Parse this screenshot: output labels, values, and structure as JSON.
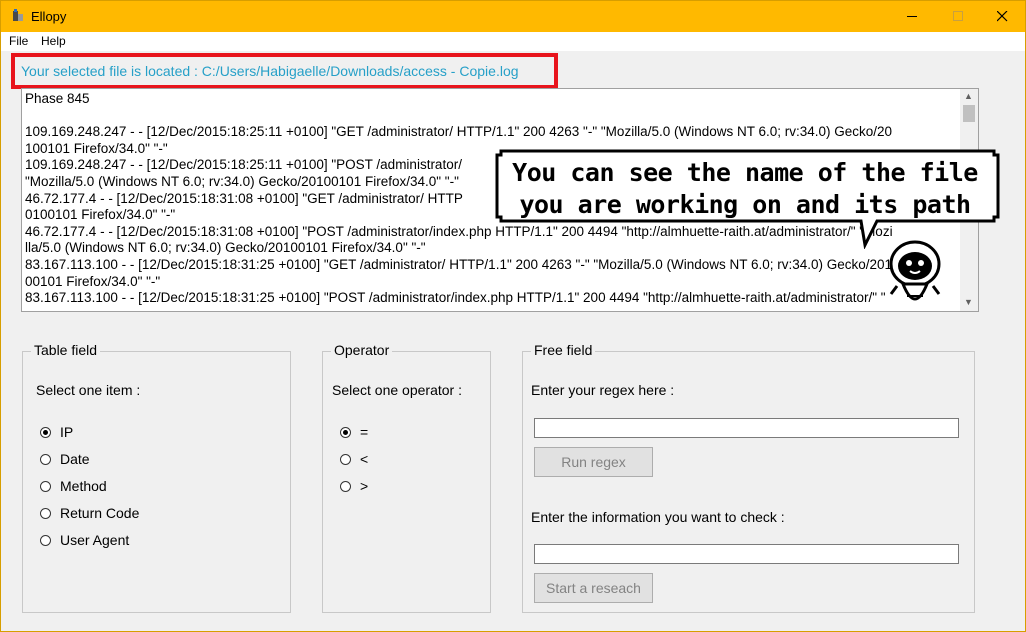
{
  "window": {
    "title": "Ellopy",
    "controls": {
      "minimize_icon": "minimize-icon",
      "maximize_icon": "maximize-icon",
      "close_icon": "close-icon"
    }
  },
  "menu": {
    "items": [
      "File",
      "Help"
    ]
  },
  "file_path": {
    "text": "Your selected file is located : C:/Users/Habigaelle/Downloads/access - Copie.log"
  },
  "log": {
    "lines": [
      "Phase 845",
      "",
      "109.169.248.247 - - [12/Dec/2015:18:25:11 +0100] \"GET /administrator/ HTTP/1.1\" 200 4263 \"-\" \"Mozilla/5.0 (Windows NT 6.0; rv:34.0) Gecko/20",
      "100101 Firefox/34.0\" \"-\"",
      "109.169.248.247 - - [12/Dec/2015:18:25:11 +0100] \"POST /administrator/",
      "\"Mozilla/5.0 (Windows NT 6.0; rv:34.0) Gecko/20100101 Firefox/34.0\" \"-\"",
      "46.72.177.4 - - [12/Dec/2015:18:31:08 +0100] \"GET /administrator/ HTTP",
      "0100101 Firefox/34.0\" \"-\"",
      "46.72.177.4 - - [12/Dec/2015:18:31:08 +0100] \"POST /administrator/index.php HTTP/1.1\" 200 4494 \"http://almhuette-raith.at/administrator/\" \"Mozi",
      "lla/5.0 (Windows NT 6.0; rv:34.0) Gecko/20100101 Firefox/34.0\" \"-\"",
      "83.167.113.100 - - [12/Dec/2015:18:31:25 +0100] \"GET /administrator/ HTTP/1.1\" 200 4263 \"-\" \"Mozilla/5.0 (Windows NT 6.0; rv:34.0) Gecko/201",
      "00101 Firefox/34.0\" \"-\"",
      "83.167.113.100 - - [12/Dec/2015:18:31:25 +0100] \"POST /administrator/index.php HTTP/1.1\" 200 4494 \"http://almhuette-raith.at/administrator/\" \""
    ]
  },
  "callout": {
    "line1": "You can see the name of the file",
    "line2": "you are working on and its path"
  },
  "table_field": {
    "title": "Table field",
    "prompt": "Select one item :",
    "options": [
      "IP",
      "Date",
      "Method",
      "Return Code",
      "User Agent"
    ],
    "selected": "IP"
  },
  "operator": {
    "title": "Operator",
    "prompt": "Select one operator :",
    "options": [
      "=",
      "<",
      ">"
    ],
    "selected": "="
  },
  "free_field": {
    "title": "Free field",
    "regex_label": "Enter your regex here :",
    "regex_value": "",
    "run_button": "Run regex",
    "check_label": "Enter the information you want to check :",
    "check_value": "",
    "search_button": "Start a reseach"
  }
}
